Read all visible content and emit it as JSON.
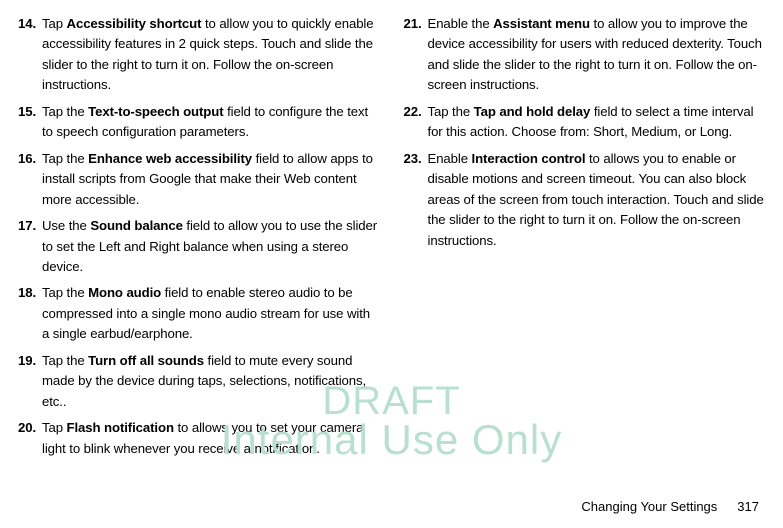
{
  "watermark": {
    "line1": "DRAFT",
    "line2": "Internal Use Only"
  },
  "footer": {
    "section": "Changing Your Settings",
    "page": "317"
  },
  "left": [
    {
      "n": "14.",
      "pre": "Tap ",
      "b": "Accessibility shortcut",
      "post": " to allow you to quickly enable accessibility features in 2 quick steps. Touch and slide the slider to the right to turn it on. Follow the on-screen instructions."
    },
    {
      "n": "15.",
      "pre": "Tap the ",
      "b": "Text-to-speech output",
      "post": " field to configure the text to speech configuration parameters."
    },
    {
      "n": "16.",
      "pre": "Tap the ",
      "b": "Enhance web accessibility",
      "post": " field to allow apps to install scripts from Google that make their Web content more accessible."
    },
    {
      "n": "17.",
      "pre": "Use the ",
      "b": "Sound balance",
      "post": " field to allow you to use the slider to set the Left and Right balance when using a stereo device."
    },
    {
      "n": "18.",
      "pre": "Tap the ",
      "b": "Mono audio",
      "post": " field to enable stereo audio to be compressed into a single mono audio stream for use with a single earbud/earphone."
    },
    {
      "n": "19.",
      "pre": "Tap the ",
      "b": "Turn off all sounds",
      "post": " field to mute every sound made by the device during taps, selections, notifications, etc.."
    },
    {
      "n": "20.",
      "pre": "Tap ",
      "b": "Flash notification",
      "post": " to allows you to set your camera light to blink whenever you receive a notification."
    }
  ],
  "right": [
    {
      "n": "21.",
      "pre": "Enable the ",
      "b": "Assistant menu",
      "post": " to allow you to improve the device accessibility for users with reduced dexterity. Touch and slide the slider to the right to turn it on. Follow the on-screen instructions."
    },
    {
      "n": "22.",
      "pre": "Tap the ",
      "b": "Tap and hold delay",
      "post": " field to select a time interval for this action. Choose from: Short, Medium, or Long."
    },
    {
      "n": "23.",
      "pre": "Enable ",
      "b": "Interaction control",
      "post": " to allows you to enable or disable motions and screen timeout. You can also block areas of the screen from touch interaction. Touch and slide the slider to the right to turn it on. Follow the on-screen instructions."
    }
  ]
}
